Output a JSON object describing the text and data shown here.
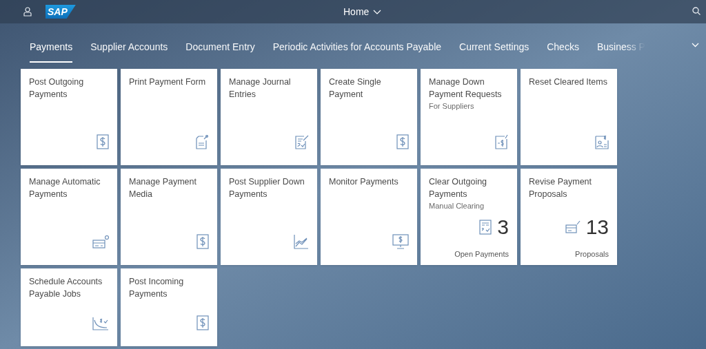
{
  "header": {
    "title": "Home",
    "logo": "SAP"
  },
  "tabs": [
    {
      "label": "Payments",
      "selected": true
    },
    {
      "label": "Supplier Accounts",
      "selected": false
    },
    {
      "label": "Document Entry",
      "selected": false
    },
    {
      "label": "Periodic Activities for Accounts Payable",
      "selected": false
    },
    {
      "label": "Current Settings",
      "selected": false
    },
    {
      "label": "Checks",
      "selected": false
    },
    {
      "label": "Business P",
      "selected": false
    }
  ],
  "tiles": [
    {
      "kind": "launch",
      "title": "Post Outgoing Payments"
    },
    {
      "kind": "launch",
      "title": "Print Payment Form"
    },
    {
      "kind": "launch",
      "title": "Manage Journal Entries"
    },
    {
      "kind": "launch",
      "title": "Create Single Payment"
    },
    {
      "kind": "launch",
      "title": "Manage Down Payment Requests",
      "subtitle": "For Suppliers"
    },
    {
      "kind": "launch",
      "title": "Reset Cleared Items"
    },
    {
      "kind": "launch",
      "title": "Manage Automatic Payments"
    },
    {
      "kind": "launch",
      "title": "Manage Payment Media"
    },
    {
      "kind": "launch",
      "title": "Post Supplier Down Payments"
    },
    {
      "kind": "launch",
      "title": "Monitor Payments"
    },
    {
      "kind": "kpi",
      "title": "Clear Outgoing Payments",
      "subtitle": "Manual Clearing",
      "number": "3",
      "footer": "Open Payments"
    },
    {
      "kind": "kpi",
      "title": "Revise Payment Proposals",
      "number": "13",
      "footer": "Proposals"
    },
    {
      "kind": "launch",
      "title": "Schedule Accounts Payable Jobs"
    },
    {
      "kind": "launch",
      "title": "Post Incoming Payments"
    }
  ]
}
